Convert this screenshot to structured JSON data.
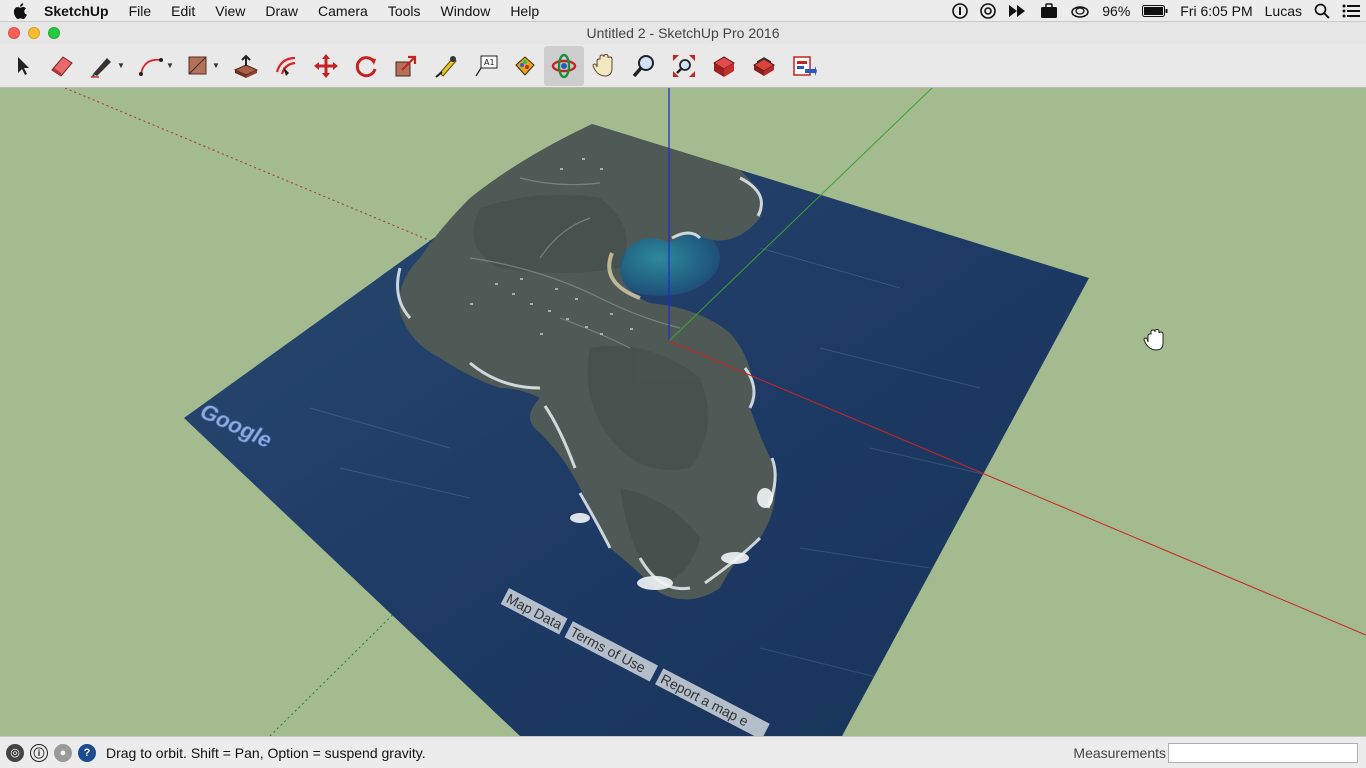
{
  "menubar": {
    "app_name": "SketchUp",
    "items": [
      "File",
      "Edit",
      "View",
      "Draw",
      "Camera",
      "Tools",
      "Window",
      "Help"
    ],
    "battery": "96%",
    "clock": "Fri 6:05 PM",
    "user": "Lucas"
  },
  "window": {
    "title": "Untitled 2 - SketchUp Pro 2016"
  },
  "toolbar": {
    "tools": [
      "select",
      "eraser",
      "pencil",
      "arc",
      "rectangle",
      "push-pull",
      "offset",
      "move",
      "rotate",
      "scale",
      "tape-measure",
      "text",
      "paint-bucket",
      "orbit",
      "pan",
      "zoom",
      "zoom-extents",
      "3d-warehouse",
      "extension-warehouse",
      "send-to-layout"
    ],
    "active_tool": "orbit"
  },
  "viewport": {
    "map_watermark": "Google",
    "map_links": [
      "Map Data",
      "Terms of Use",
      "Report a map e"
    ]
  },
  "statusbar": {
    "hint": "Drag to orbit. Shift = Pan, Option = suspend gravity.",
    "measurements_label": "Measurements",
    "measurements_value": ""
  },
  "colors": {
    "ground": "#a3bb8f",
    "axis_red": "#cc2222",
    "axis_green": "#33aa33",
    "axis_blue": "#2222cc",
    "sea": "#1f3f6e",
    "land": "#4f5a57"
  }
}
